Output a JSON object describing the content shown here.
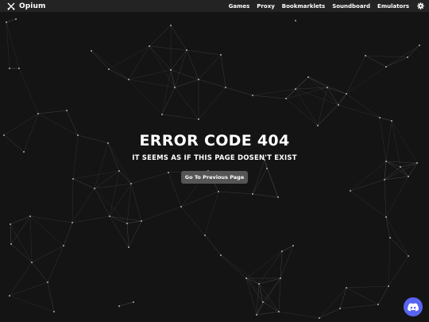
{
  "app": {
    "name": "Opium",
    "logo_icon": "crossed-swords-icon"
  },
  "nav": {
    "items": [
      {
        "label": "Games"
      },
      {
        "label": "Proxy"
      },
      {
        "label": "Bookmarklets"
      },
      {
        "label": "Soundboard"
      },
      {
        "label": "Emulators"
      }
    ],
    "settings_icon": "gear-icon"
  },
  "error": {
    "title": "ERROR CODE 404",
    "subtitle": "IT SEEMS AS IF THIS PAGE DOSEN'T EXIST",
    "button_label": "Go To Previous Page"
  },
  "floating": {
    "discord_icon": "discord-icon"
  },
  "colors": {
    "background": "#141414",
    "topbar": "#232323",
    "button": "#555555",
    "discord": "#5865f2",
    "network_line": "#6b6b6b",
    "network_node": "#d8d8d8"
  }
}
